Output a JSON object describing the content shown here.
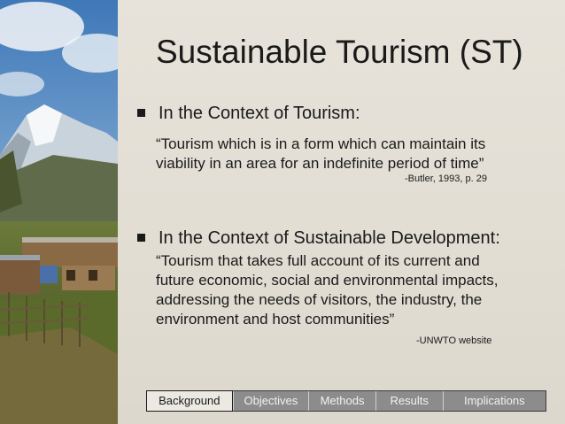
{
  "slide": {
    "title": "Sustainable Tourism (ST)",
    "bullets": [
      {
        "heading": "In the Context of Tourism:",
        "quote_lines": [
          "“Tourism which is in a form which can maintain its",
          "viability in an area for an indefinite period of time”"
        ],
        "attribution": "-Butler, 1993, p. 29"
      },
      {
        "heading": "In the Context of Sustainable Development:",
        "quote_lines": [
          "“Tourism that takes full account of its current and",
          "future economic, social and environmental impacts,",
          "addressing the needs of visitors, the industry, the",
          "environment and host communities”"
        ],
        "attribution": "-UNWTO website"
      }
    ]
  },
  "nav": {
    "tabs": [
      "Background",
      "Objectives",
      "Methods",
      "Results",
      "Implications"
    ],
    "active": "Background"
  },
  "colors": {
    "background": "#e3dfd6",
    "text": "#1a1a1a",
    "nav_inactive": "#8c8c8c",
    "nav_active": "#ece9e2"
  }
}
